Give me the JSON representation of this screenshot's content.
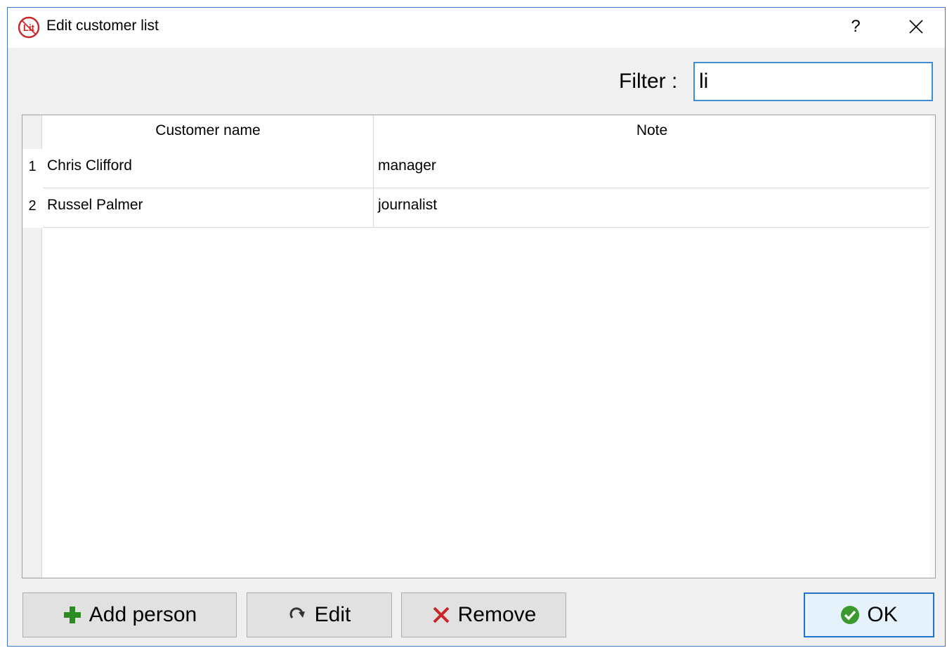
{
  "window": {
    "title": "Edit customer list",
    "help_label": "?",
    "app_icon_text": "Lit",
    "app_icon_color": "#c8262a"
  },
  "filter": {
    "label": "Filter :",
    "value": "li"
  },
  "table": {
    "columns": [
      "Customer name",
      "Note"
    ],
    "rows": [
      {
        "num": "1",
        "name": "Chris Clifford",
        "note": "manager"
      },
      {
        "num": "2",
        "name": "Russel Palmer",
        "note": "journalist"
      }
    ]
  },
  "buttons": {
    "add": {
      "label": "Add person",
      "icon": "plus-icon",
      "icon_color": "#2e8b22"
    },
    "edit": {
      "label": "Edit",
      "icon": "redo-icon"
    },
    "remove": {
      "label": "Remove",
      "icon": "x-icon",
      "icon_color": "#c8262a"
    },
    "ok": {
      "label": "OK",
      "icon": "check-circle-icon",
      "icon_color": "#3a9a2e"
    }
  }
}
